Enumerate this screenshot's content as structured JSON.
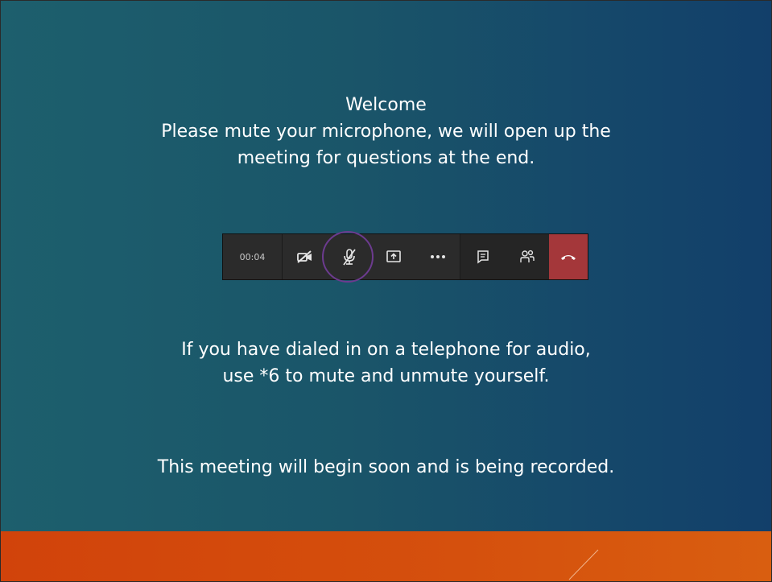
{
  "slide": {
    "welcome": {
      "title": "Welcome",
      "line1": "Please mute your microphone, we will open up the",
      "line2": "meeting for questions at the end."
    },
    "phone_note": {
      "line1": "If you have dialed in on a telephone for audio,",
      "line2": "use *6 to mute and unmute yourself."
    },
    "recording_note": "This meeting will begin soon and is being recorded."
  },
  "toolbar": {
    "timer": "00:04",
    "buttons": [
      {
        "name": "camera-off-icon"
      },
      {
        "name": "microphone-muted-icon",
        "highlighted": true
      },
      {
        "name": "share-screen-icon"
      },
      {
        "name": "more-options-icon"
      },
      {
        "name": "chat-icon"
      },
      {
        "name": "participants-icon"
      },
      {
        "name": "hang-up-icon"
      }
    ],
    "colors": {
      "background": "#2b2b2b",
      "hangup": "#a4373a",
      "highlight_ring": "#6c3b8f"
    }
  },
  "theme": {
    "background_left": "#1d5f6d",
    "background_right": "#123f6a",
    "footer_band": "#d5500d",
    "text": "#ffffff"
  }
}
